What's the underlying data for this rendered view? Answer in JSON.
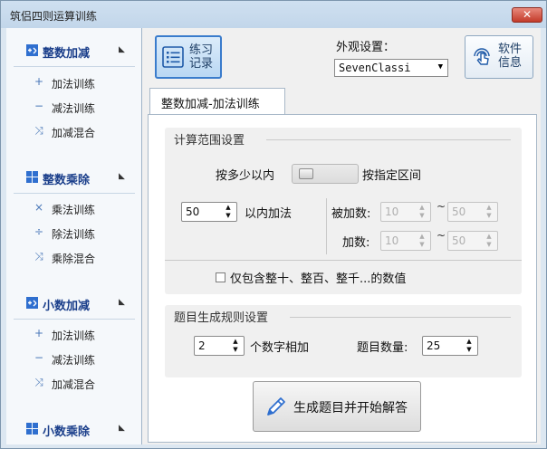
{
  "window": {
    "title": "筑侣四则运算训练",
    "close_glyph": "✕"
  },
  "sidebar": {
    "groups": [
      {
        "label": "整数加减",
        "items": [
          {
            "icon": "plus-icon",
            "glyph": "+",
            "label": "加法训练"
          },
          {
            "icon": "minus-icon",
            "glyph": "−",
            "label": "减法训练"
          },
          {
            "icon": "shuffle-icon",
            "glyph": "⤨",
            "label": "加减混合"
          }
        ]
      },
      {
        "label": "整数乘除",
        "items": [
          {
            "icon": "multiply-icon",
            "glyph": "×",
            "label": "乘法训练"
          },
          {
            "icon": "divide-icon",
            "glyph": "÷",
            "label": "除法训练"
          },
          {
            "icon": "shuffle-icon",
            "glyph": "⤨",
            "label": "乘除混合"
          }
        ]
      },
      {
        "label": "小数加减",
        "items": [
          {
            "icon": "plus-icon",
            "glyph": "+",
            "label": "加法训练"
          },
          {
            "icon": "minus-icon",
            "glyph": "−",
            "label": "减法训练"
          },
          {
            "icon": "shuffle-icon",
            "glyph": "⤨",
            "label": "加减混合"
          }
        ]
      },
      {
        "label": "小数乘除",
        "items": []
      }
    ]
  },
  "toolbar": {
    "practice_label": "练习记录",
    "appearance_label": "外观设置：",
    "appearance_value": "SevenClassi",
    "about_label": "软件信息"
  },
  "tab": {
    "label": "整数加减-加法训练"
  },
  "range_group": {
    "title": "计算范围设置",
    "toggle_left_label": "按多少以内",
    "toggle_right_label": "按指定区间",
    "limit_value": "50",
    "limit_suffix": "以内加法",
    "addend1_label": "被加数:",
    "addend1_min": "10",
    "addend1_max": "50",
    "addend2_label": "加数:",
    "addend2_min": "10",
    "addend2_max": "50",
    "tilde": "~",
    "round_only_label": "仅包含整十、整百、整千...的数值"
  },
  "rules_group": {
    "title": "题目生成规则设置",
    "count_value": "2",
    "count_suffix": "个数字相加",
    "qty_label": "题目数量:",
    "qty_value": "25"
  },
  "generate_button": {
    "label": "生成题目并开始解答"
  },
  "colors": {
    "accent": "#3a7ccc",
    "sidebar_heading": "#1b3f8b",
    "close": "#c33b2a"
  }
}
